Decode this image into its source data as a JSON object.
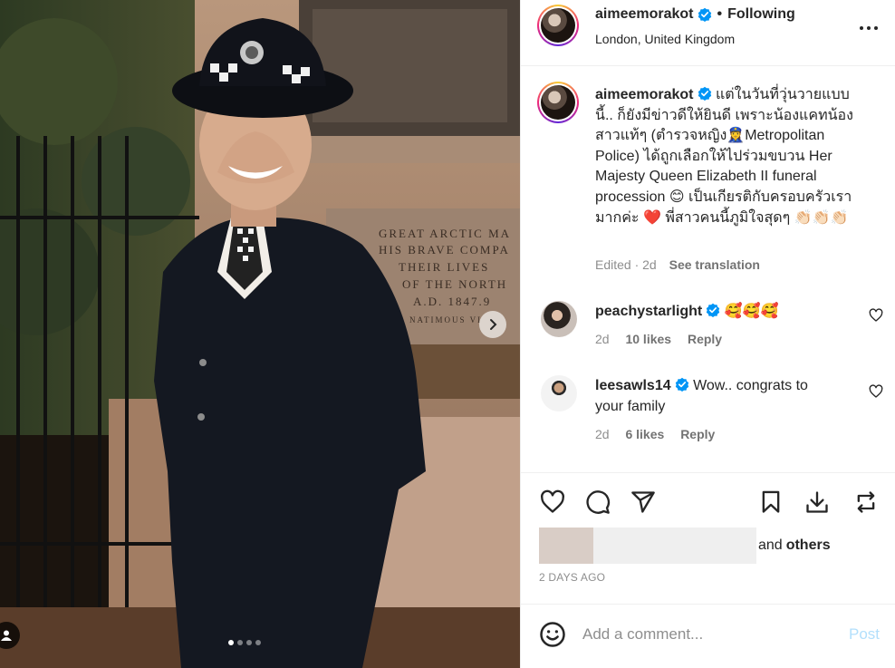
{
  "post": {
    "author": "aimeemorakot",
    "follow_status": "Following",
    "separator": "•",
    "location": "London, United Kingdom",
    "more_icon": "more-horizontal-icon",
    "verified_icon": "verified-badge-icon"
  },
  "photo": {
    "carousel_count": 4,
    "carousel_active": 1,
    "plaque_lines": [
      "GREAT ARCTIC MA",
      "HIS BRAVE COMPA",
      "THEIR LIVES",
      "OF THE NORTH",
      "A.D. 1847.9",
      "NATIMOUS VI"
    ]
  },
  "caption": {
    "text": "แต่ในวันที่วุ่นวายแบบนี้.. ก็ยังมีข่าวดีให้ยินดี เพราะน้องแคทน้องสาวแท้ๆ (ตำรวจหญิง👮‍♀️Metropolitan Police) ได้ถูกเลือกให้ไปร่วมขบวน Her Majesty Queen Elizabeth II funeral procession 😊 เป็นเกียรติกับครอบครัวเรามากค่ะ ❤️ พี่สาวคนนี้ภูมิใจสุดๆ 👏🏻👏🏻👏🏻",
    "edited": "Edited · 2d",
    "see_translation": "See translation"
  },
  "comments": [
    {
      "user": "peachystarlight",
      "text": "🥰🥰🥰",
      "age": "2d",
      "likes": "10 likes",
      "reply": "Reply"
    },
    {
      "user": "leesawls14",
      "text": "Wow.. congrats to your family",
      "age": "2d",
      "likes": "6 likes",
      "reply": "Reply"
    }
  ],
  "liked_by": {
    "and": "and",
    "others": "others"
  },
  "timestamp": "2 DAYS AGO",
  "add_comment": {
    "placeholder": "Add a comment...",
    "post_label": "Post"
  },
  "colors": {
    "text": "#262626",
    "muted": "#8e8e8e",
    "verified": "#0095f6",
    "post_disabled": "#b2dffc",
    "heart_red": "#ed4956"
  }
}
